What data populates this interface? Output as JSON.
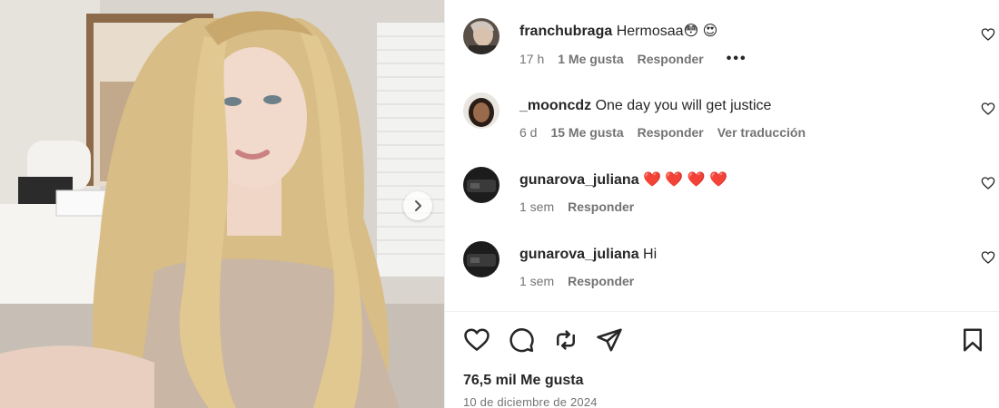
{
  "post": {
    "comments": [
      {
        "username": "franchubraga",
        "text": "Hermosaa😳 😍",
        "time": "17 h",
        "likes": "1 Me gusta",
        "reply": "Responder",
        "more": "•••",
        "avatar_color": "#c9b9a6"
      },
      {
        "username": "_mooncdz",
        "text": "One day you will get justice",
        "time": "6 d",
        "likes": "15 Me gusta",
        "reply": "Responder",
        "translate": "Ver traducción",
        "avatar_color": "#7a5a44"
      },
      {
        "username": "gunarova_juliana",
        "text": "❤️ ❤️ ❤️ ❤️",
        "time": "1 sem",
        "reply": "Responder",
        "avatar_color": "#2b2b2b"
      },
      {
        "username": "gunarova_juliana",
        "text": "Hi",
        "time": "1 sem",
        "reply": "Responder",
        "avatar_color": "#2b2b2b"
      }
    ],
    "like_count": "76,5 mil Me gusta",
    "date": "10 de diciembre de 2024",
    "icons": {
      "like": "heart-icon",
      "comment": "comment-icon",
      "repost": "repost-icon",
      "share": "share-icon",
      "save": "bookmark-icon",
      "next": "chevron-right-icon"
    }
  }
}
